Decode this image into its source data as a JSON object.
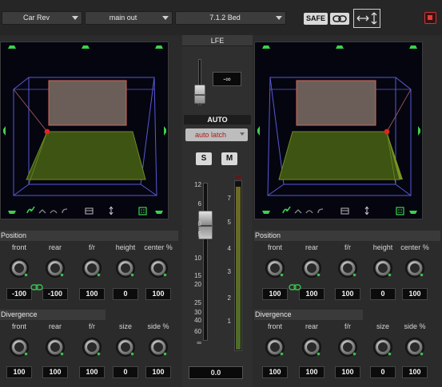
{
  "header": {
    "source_select": "Car Rev",
    "output_select": "main out",
    "format_select": "7.1.2 Bed",
    "safe_label": "SAFE",
    "link_icon": "link-icon",
    "mode_icon": "expand-arrows-icon",
    "close_icon": "close-icon"
  },
  "panners": [
    {
      "side": "left"
    },
    {
      "side": "right"
    }
  ],
  "left": {
    "position_title": "Position",
    "position_knobs": [
      {
        "label": "front",
        "value": "-100"
      },
      {
        "label": "rear",
        "value": "-100"
      },
      {
        "label": "f/r",
        "value": "100"
      },
      {
        "label": "height",
        "value": "0"
      },
      {
        "label": "center %",
        "value": "100"
      }
    ],
    "divergence_title": "Divergence",
    "divergence_knobs": [
      {
        "label": "front",
        "value": "100"
      },
      {
        "label": "rear",
        "value": "100"
      },
      {
        "label": "f/r",
        "value": "100"
      },
      {
        "label": "size",
        "value": "0"
      },
      {
        "label": "side %",
        "value": "100"
      }
    ]
  },
  "right": {
    "position_title": "Position",
    "position_knobs": [
      {
        "label": "front",
        "value": "100"
      },
      {
        "label": "rear",
        "value": "100"
      },
      {
        "label": "f/r",
        "value": "100"
      },
      {
        "label": "height",
        "value": "0"
      },
      {
        "label": "center %",
        "value": "100"
      }
    ],
    "divergence_title": "Divergence",
    "divergence_knobs": [
      {
        "label": "front",
        "value": "100"
      },
      {
        "label": "rear",
        "value": "100"
      },
      {
        "label": "f/r",
        "value": "100"
      },
      {
        "label": "size",
        "value": "0"
      },
      {
        "label": "side %",
        "value": "100"
      }
    ]
  },
  "center": {
    "lfe_label": "LFE",
    "lfe_value": "-∞",
    "automation_label": "AUTO",
    "automation_mode": "auto latch",
    "solo_label": "S",
    "mute_label": "M",
    "fader_scale": [
      "12",
      "6",
      "0",
      "5",
      "10",
      "15",
      "20",
      "25",
      "30",
      "40",
      "60",
      "∞"
    ],
    "meter_scale": [
      "7",
      "5",
      "4",
      "3",
      "2",
      "1"
    ],
    "fader_value": "0.0"
  },
  "colors": {
    "floor": "#3e5413",
    "ceiling": "#6b5e58",
    "ceiling_edge": "#d0695b",
    "wireframe": "#5858d8",
    "puck": "#e0261d",
    "speaker": "#3bd24b",
    "knob_indicator": "#37c24c"
  }
}
